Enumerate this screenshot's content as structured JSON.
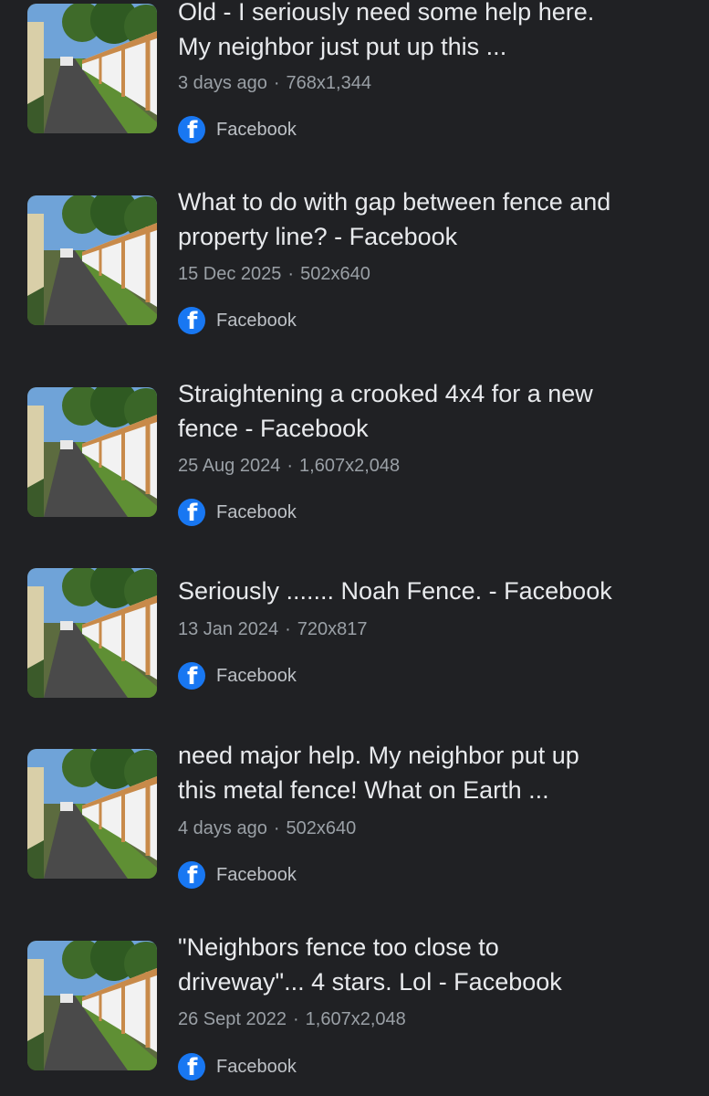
{
  "colors": {
    "background": "#202124",
    "title": "#e8eaed",
    "meta": "#9aa0a6",
    "facebook_blue": "#1877f2"
  },
  "results": [
    {
      "title_lines": [
        "Old - I seriously need some help here.",
        "My neighbor just put up this ..."
      ],
      "date": "3 days ago",
      "dimensions": "768x1,344",
      "source_icon": "facebook-icon",
      "source": "Facebook"
    },
    {
      "title_lines": [
        "What to do with gap between fence and",
        "property line? - Facebook"
      ],
      "date": "15 Dec 2025",
      "dimensions": "502x640",
      "source_icon": "facebook-icon",
      "source": "Facebook"
    },
    {
      "title_lines": [
        "Straightening a crooked 4x4 for a new",
        "fence - Facebook"
      ],
      "date": "25 Aug 2024",
      "dimensions": "1,607x2,048",
      "source_icon": "facebook-icon",
      "source": "Facebook"
    },
    {
      "title_lines": [
        "Seriously ....... Noah Fence. - Facebook"
      ],
      "date": "13 Jan 2024",
      "dimensions": "720x817",
      "source_icon": "facebook-icon",
      "source": "Facebook"
    },
    {
      "title_lines": [
        "need major help. My neighbor put up",
        "this metal fence! What on Earth ..."
      ],
      "date": "4 days ago",
      "dimensions": "502x640",
      "source_icon": "facebook-icon",
      "source": "Facebook"
    },
    {
      "title_lines": [
        "\"Neighbors fence too close to",
        "driveway\"... 4 stars. Lol - Facebook"
      ],
      "date": "26 Sept 2022",
      "dimensions": "1,607x2,048",
      "source_icon": "facebook-icon",
      "source": "Facebook"
    }
  ]
}
